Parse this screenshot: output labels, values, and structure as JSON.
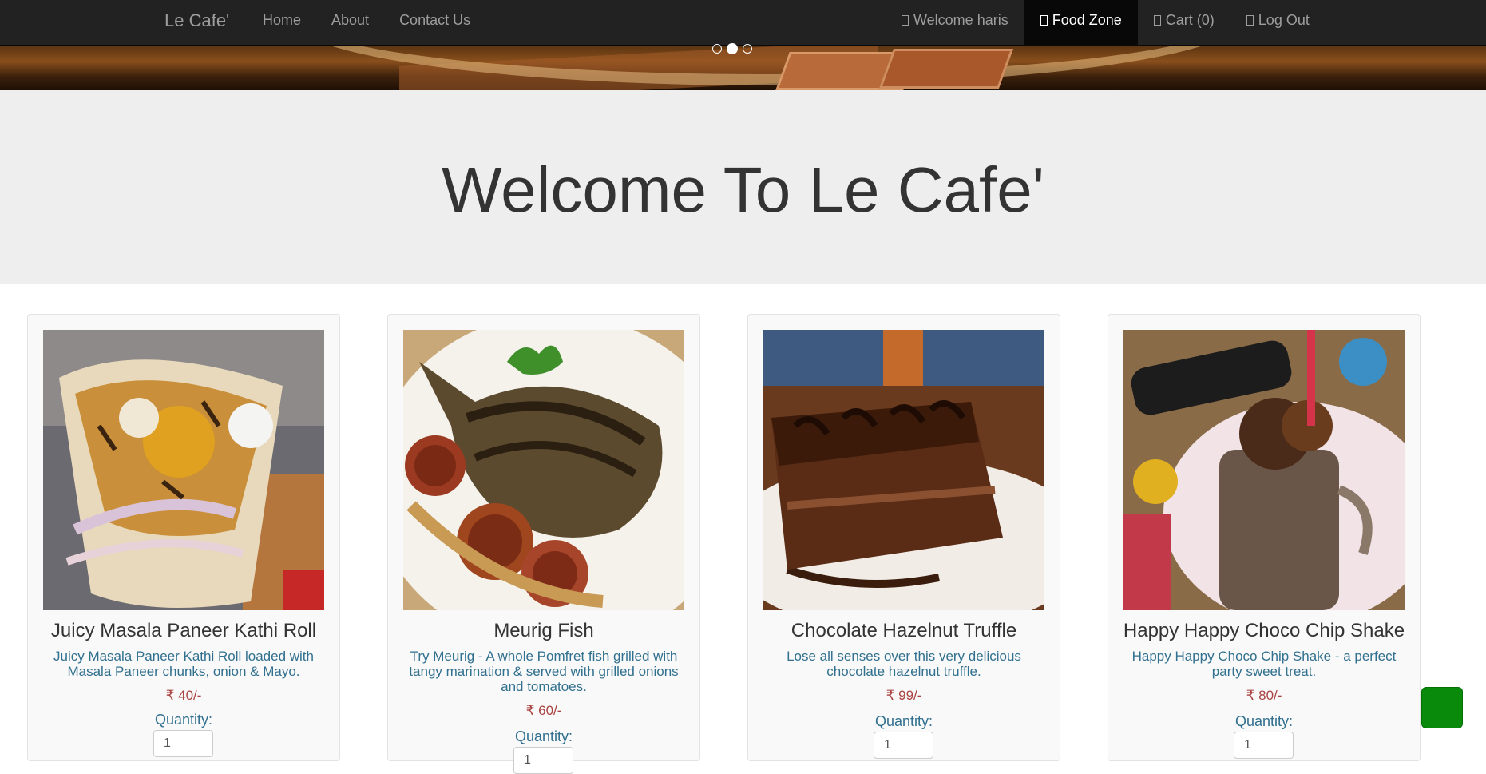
{
  "navbar": {
    "brand": "Le Cafe'",
    "left_links": [
      "Home",
      "About",
      "Contact Us"
    ],
    "welcome": "Welcome haris",
    "food_zone": "Food Zone",
    "cart": "Cart (0)",
    "logout": "Log Out",
    "icon_glyph": ""
  },
  "carousel": {
    "indicator_count": 3,
    "active_index": 1
  },
  "jumbotron": {
    "title": "Welcome To Le Cafe'"
  },
  "menu": [
    {
      "name": "Juicy Masala Paneer Kathi Roll",
      "description": "Juicy Masala Paneer Kathi Roll loaded with Masala Paneer chunks, onion & Mayo.",
      "price": "₹ 40/-",
      "quantity_label": "Quantity:",
      "quantity": "1",
      "icon": "kathi-roll-image"
    },
    {
      "name": "Meurig Fish",
      "description": "Try Meurig - A whole Pomfret fish grilled with tangy marination & served with grilled onions and tomatoes.",
      "price": "₹ 60/-",
      "quantity_label": "Quantity:",
      "quantity": "1",
      "icon": "grilled-fish-image"
    },
    {
      "name": "Chocolate Hazelnut Truffle",
      "description": "Lose all senses over this very delicious chocolate hazelnut truffle.",
      "price": "₹ 99/-",
      "quantity_label": "Quantity:",
      "quantity": "1",
      "icon": "chocolate-cake-image"
    },
    {
      "name": "Happy Happy Choco Chip Shake",
      "description": "Happy Happy Choco Chip Shake - a perfect party sweet treat.",
      "price": "₹ 80/-",
      "quantity_label": "Quantity:",
      "quantity": "1",
      "icon": "choco-shake-image"
    }
  ],
  "chat_button": {
    "glyph": ""
  },
  "colors": {
    "navbar": "#222222",
    "jumbotron": "#eeeeee",
    "description": "#31708f",
    "price": "#a94442",
    "chat": "#0a8a0a"
  }
}
